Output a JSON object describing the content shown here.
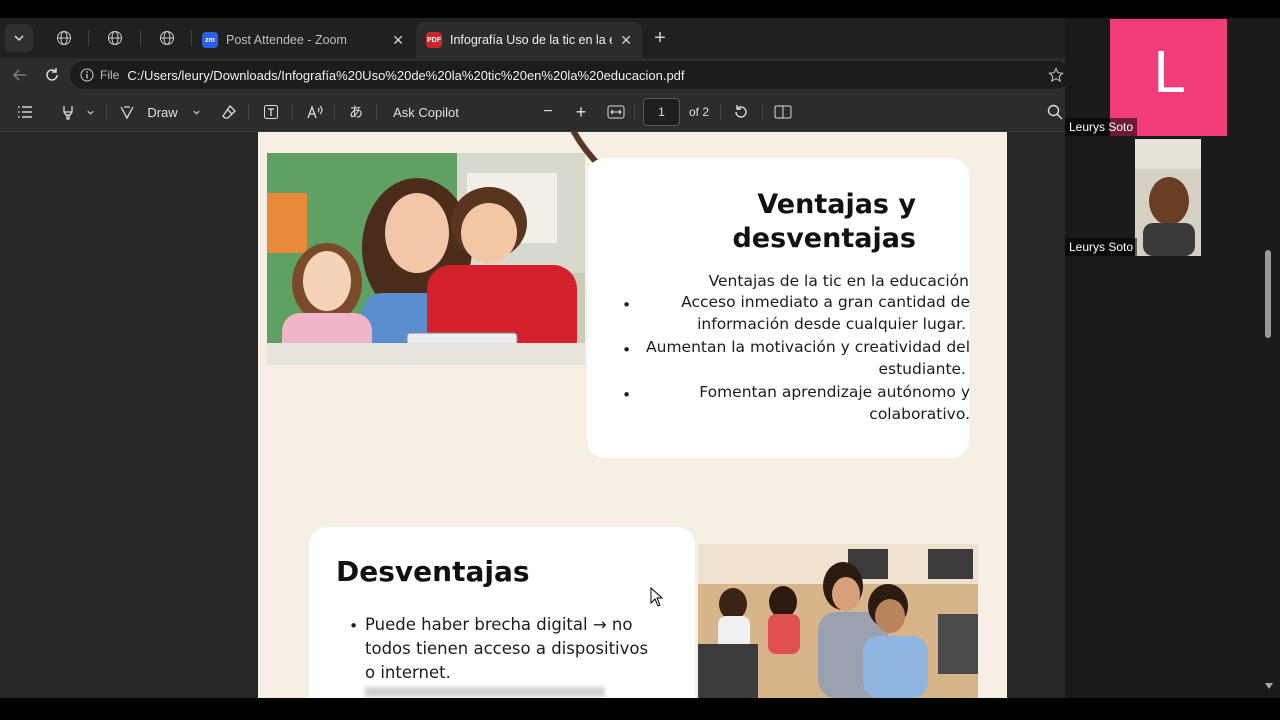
{
  "browser": {
    "tabs": [
      {
        "title": "Post Attendee - Zoom",
        "icon": "zoom-icon"
      },
      {
        "title": "Infografía Uso de la tic en la educa",
        "icon": "pdf-icon"
      }
    ],
    "address": {
      "label": "File",
      "url": "C:/Users/leury/Downloads/Infografía%20Uso%20de%20la%20tic%20en%20la%20educacion.pdf"
    }
  },
  "pdf_toolbar": {
    "draw_label": "Draw",
    "copilot_label": "Ask Copilot",
    "page_value": "1",
    "page_total": "of 2"
  },
  "document": {
    "ventajas": {
      "title_line1": "Ventajas y",
      "title_line2": "desventajas",
      "intro": "Ventajas de la tic en la educación",
      "items": [
        {
          "line1": "Acceso inmediato a gran cantidad de",
          "line2": "información desde cualquier lugar."
        },
        {
          "line1": "Aumentan la motivación y creatividad del",
          "line2": "estudiante."
        },
        {
          "line1": "Fomentan aprendizaje autónomo y",
          "line2": "colaborativo."
        }
      ]
    },
    "desventajas": {
      "title": "Desventajas",
      "items": [
        {
          "line1": "Puede haber brecha digital → no",
          "line2": "todos tienen acceso a dispositivos",
          "line3": "o internet."
        }
      ]
    }
  },
  "zoom": {
    "participant1": {
      "initial": "L",
      "name": "Leurys Soto",
      "color": "#f23c77"
    },
    "participant2": {
      "name": "Leurys Soto"
    }
  }
}
